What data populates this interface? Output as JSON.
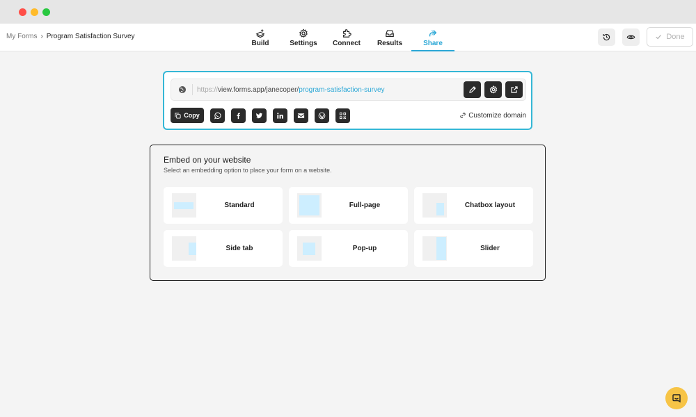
{
  "breadcrumb": {
    "parent": "My Forms",
    "separator": "›",
    "current": "Program Satisfaction Survey"
  },
  "tabs": [
    {
      "label": "Build",
      "icon": "build-icon"
    },
    {
      "label": "Settings",
      "icon": "gear-icon"
    },
    {
      "label": "Connect",
      "icon": "puzzle-icon"
    },
    {
      "label": "Results",
      "icon": "inbox-icon"
    },
    {
      "label": "Share",
      "icon": "share-icon",
      "active": true
    }
  ],
  "toolbar": {
    "history_icon": "history-icon",
    "preview_icon": "eye-icon",
    "done_label": "Done"
  },
  "share": {
    "url_protocol": "https://",
    "url_host": "view.forms.app/janecoper/",
    "url_slug": "program-satisfaction-survey",
    "copy_label": "Copy",
    "customize_label": "Customize domain",
    "socials": [
      "whatsapp-icon",
      "facebook-icon",
      "twitter-icon",
      "linkedin-icon",
      "email-icon",
      "wordpress-icon",
      "qr-code-icon"
    ]
  },
  "embed": {
    "title": "Embed on your website",
    "subtitle": "Select an embedding option to place your form on a website.",
    "options": [
      "Standard",
      "Full-page",
      "Chatbox layout",
      "Side tab",
      "Pop-up",
      "Slider"
    ]
  },
  "colors": {
    "accent": "#2aa7d6",
    "card_border": "#35b7d6",
    "dark_button": "#2b2b2b",
    "chat_bubble": "#f7c446"
  }
}
